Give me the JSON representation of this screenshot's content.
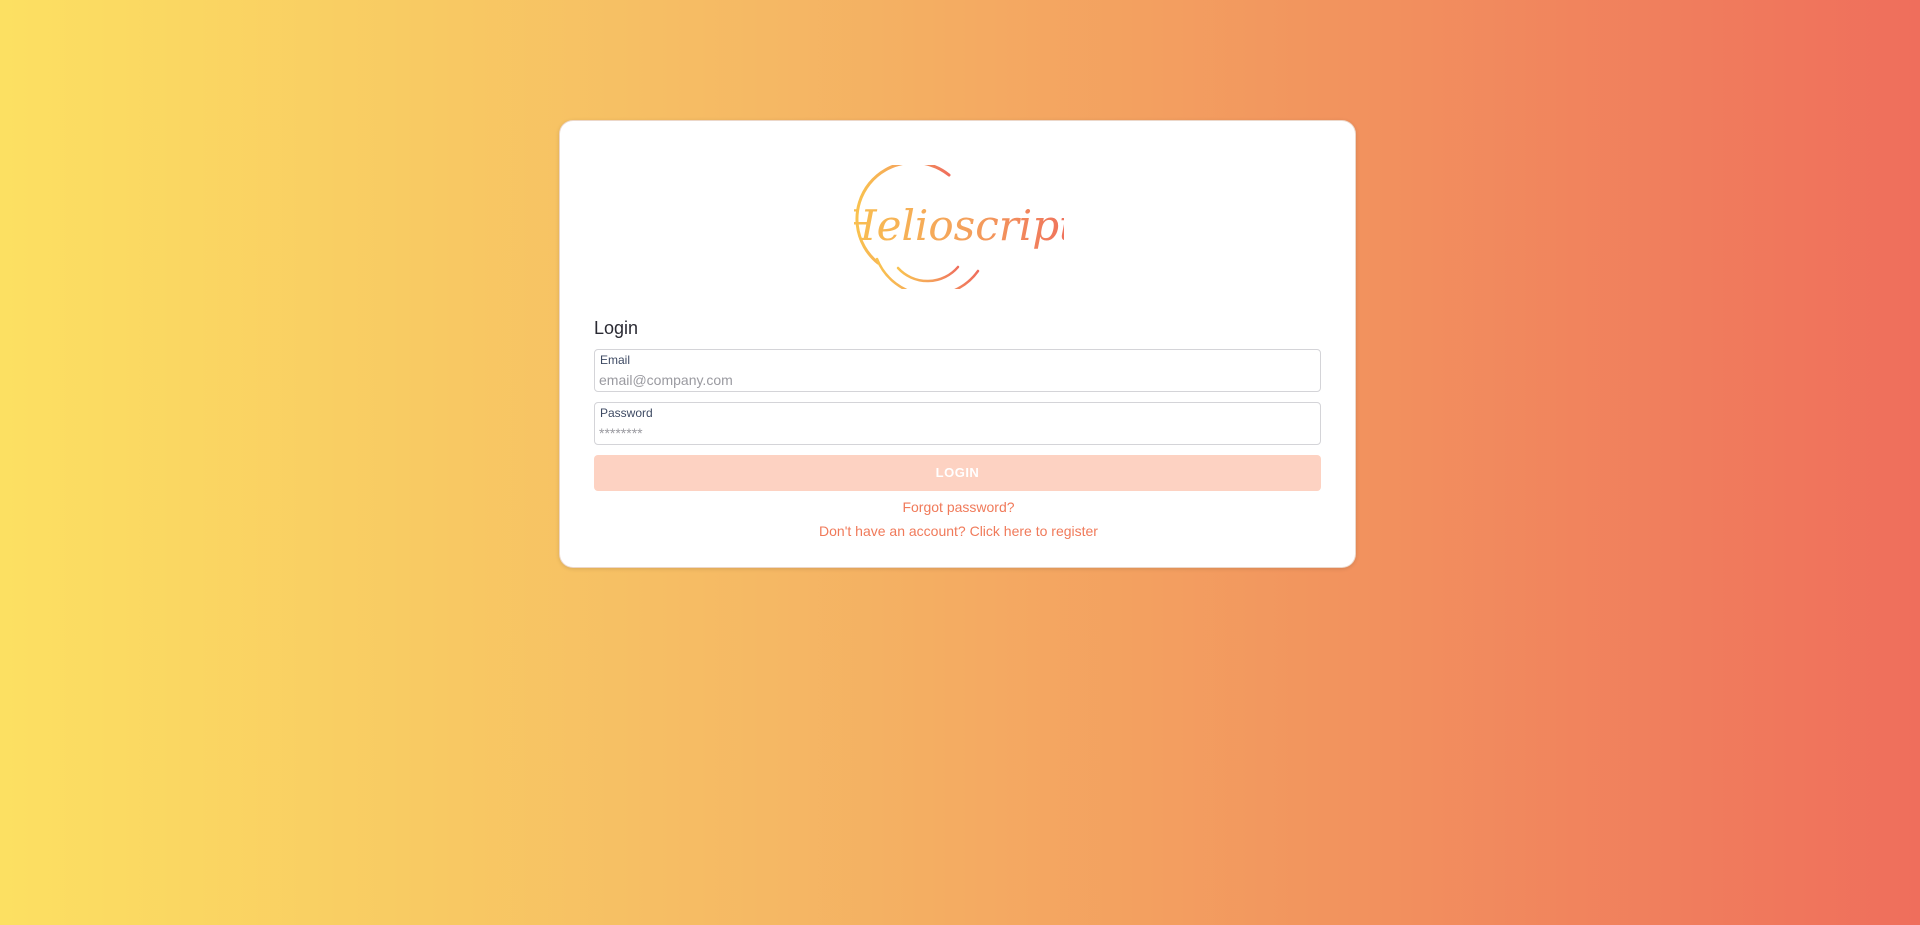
{
  "brand": {
    "logo_text": "Helioscript",
    "logo_icon": "sun-arc-logo",
    "gradient_start": "#f9c24f",
    "gradient_end": "#ef6e5c"
  },
  "form": {
    "heading": "Login",
    "email": {
      "label": "Email",
      "placeholder": "email@company.com",
      "value": ""
    },
    "password": {
      "label": "Password",
      "placeholder": "********",
      "value": ""
    },
    "submit_label": "LOGIN"
  },
  "links": {
    "forgot_password": "Forgot password?",
    "register": "Don't have an account? Click here to register"
  },
  "colors": {
    "accent": "#f07a5a",
    "button_disabled": "#fdd2c2",
    "background_start": "#fce062",
    "background_end": "#ef6e5c"
  }
}
